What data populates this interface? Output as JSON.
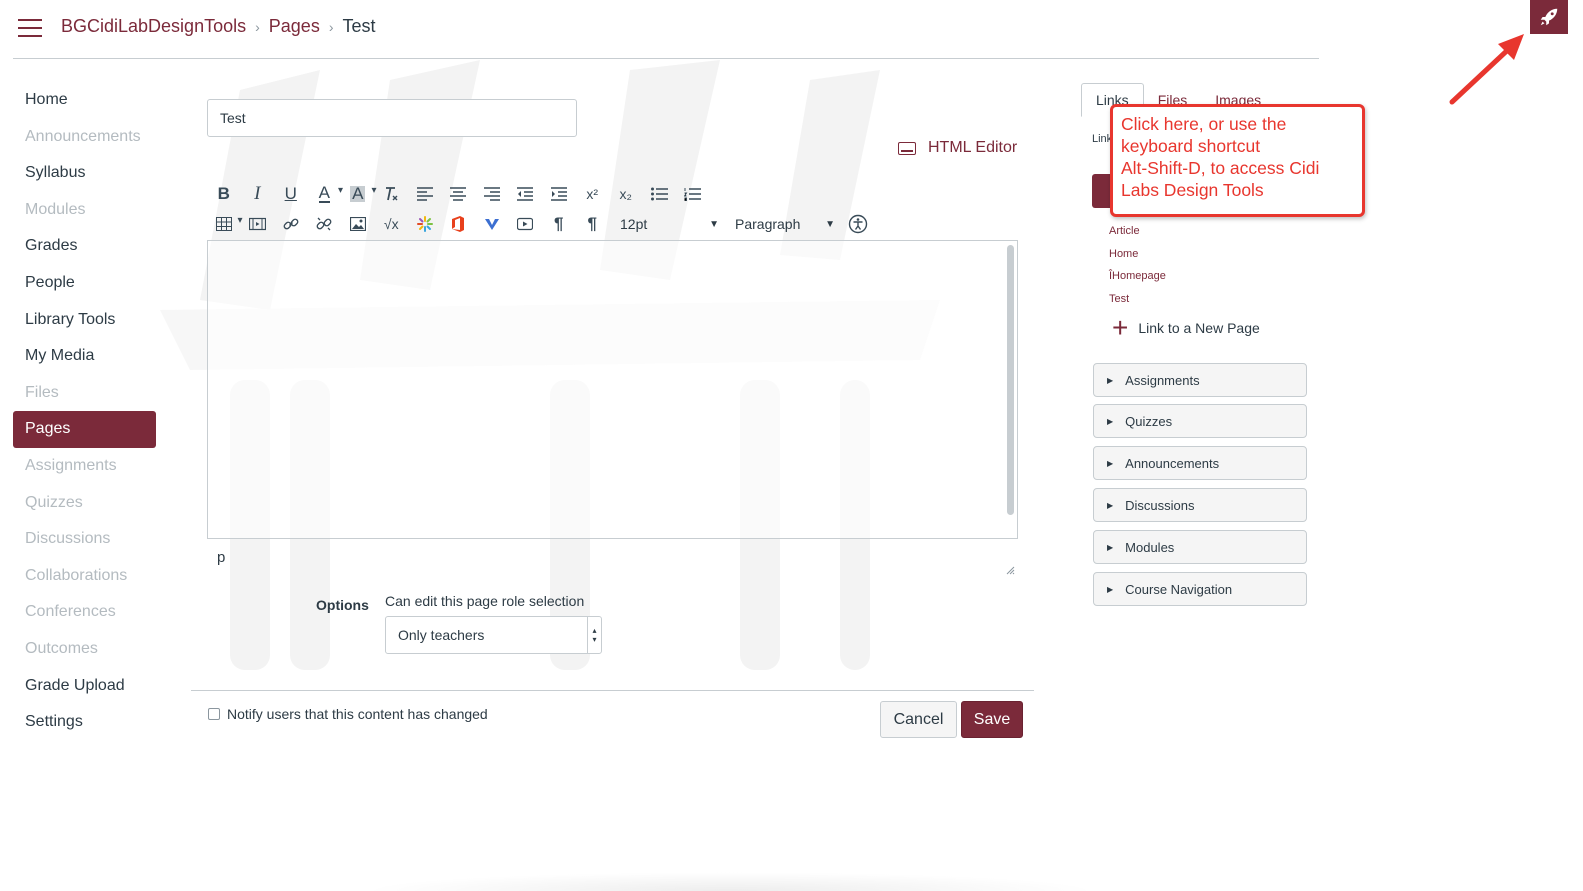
{
  "breadcrumb": {
    "course": "BGCidiLabDesignTools",
    "section": "Pages",
    "current": "Test"
  },
  "icons": {
    "menu": "hamburger-icon",
    "rocket": "rocket-icon",
    "keyboard": "keyboard-icon",
    "arrow": "red-arrow-annotation"
  },
  "colors": {
    "brand": "#7b2a3a",
    "annotation": "#e8362e",
    "muted": "#b4bbc0",
    "text": "#2d3b45"
  },
  "nav": {
    "home": "Home",
    "announcements": "Announcements",
    "syllabus": "Syllabus",
    "modules": "Modules",
    "grades": "Grades",
    "people": "People",
    "library_tools": "Library Tools",
    "my_media": "My Media",
    "files": "Files",
    "pages": "Pages",
    "assignments": "Assignments",
    "quizzes": "Quizzes",
    "discussions": "Discussions",
    "collaborations": "Collaborations",
    "conferences": "Conferences",
    "outcomes": "Outcomes",
    "grade_upload": "Grade Upload",
    "settings": "Settings"
  },
  "editor": {
    "title_value": "Test",
    "html_editor_label": "HTML Editor",
    "font_size": "12pt",
    "block_format": "Paragraph",
    "status_path": "p",
    "toolbar": {
      "bold": "B",
      "italic": "I",
      "underline": "U",
      "superscript": "x²",
      "subscript": "x₂",
      "sqrt": "√x",
      "pilcrow": "¶"
    }
  },
  "options": {
    "label": "Options",
    "role_label": "Can edit this page role selection",
    "role_value": "Only teachers"
  },
  "footer": {
    "notify_label": "Notify users that this content has changed",
    "cancel": "Cancel",
    "save": "Save"
  },
  "sidebar": {
    "tabs": {
      "links": "Links",
      "files": "Files",
      "images": "Images"
    },
    "links_desc": "Link to other content in the course. Click any page",
    "pages": {
      "article": "Article",
      "home": "Home",
      "homepage": "ÎHomepage",
      "test": "Test"
    },
    "new_page": "Link to a New Page",
    "accordions": {
      "assignments": "Assignments",
      "quizzes": "Quizzes",
      "announcements": "Announcements",
      "discussions": "Discussions",
      "modules": "Modules",
      "course_navigation": "Course Navigation"
    }
  },
  "callout": {
    "line1": "Click here, or use the",
    "line2": "keyboard shortcut",
    "line3": "Alt-Shift-D, to access Cidi",
    "line4": "Labs Design Tools"
  }
}
